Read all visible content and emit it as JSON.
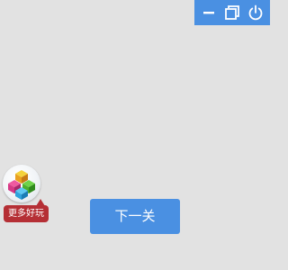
{
  "window_controls": {
    "icons": [
      "minimize-icon",
      "restore-icon",
      "power-icon"
    ],
    "accent_color": "#4a90e2"
  },
  "promo": {
    "icon": "game-cubes-icon",
    "label": "更多好玩",
    "label_color": "#b52f35"
  },
  "main": {
    "next_label": "下一关",
    "button_color": "#4a90e2"
  },
  "background_color": "#e2e2e2"
}
